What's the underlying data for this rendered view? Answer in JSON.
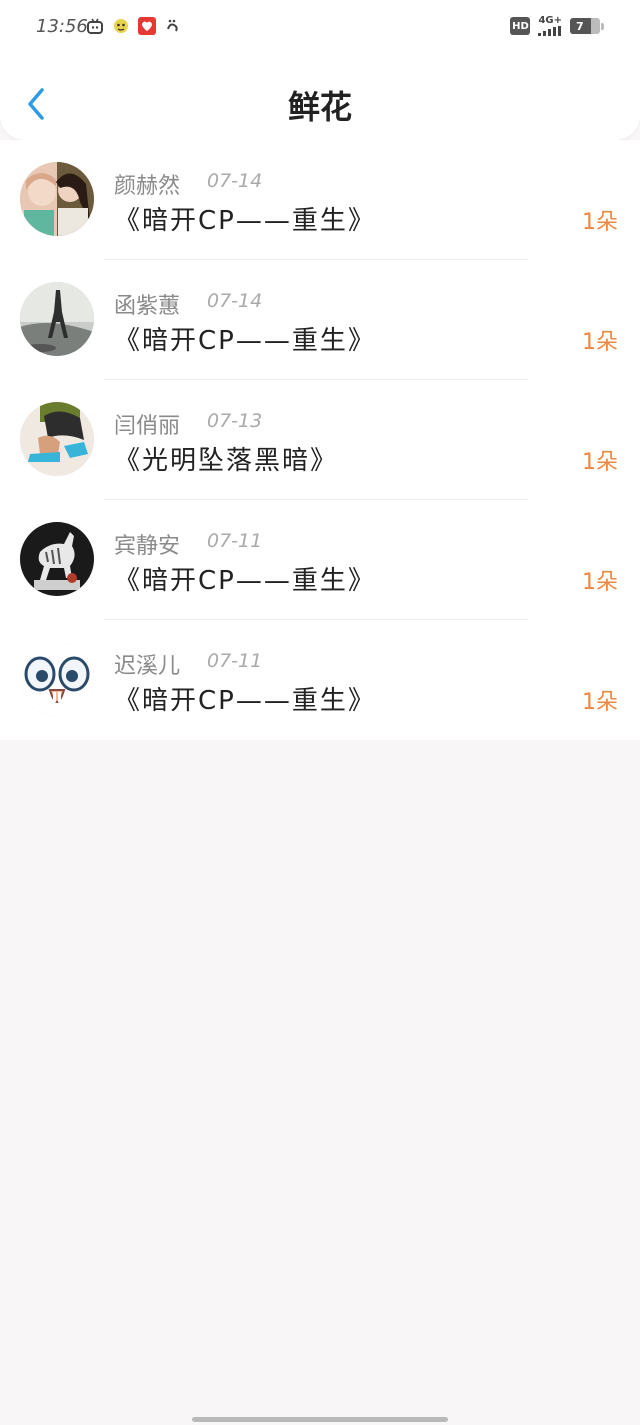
{
  "status_bar": {
    "time": "13:56",
    "hd_label": "HD",
    "network_label": "4G+",
    "battery_level": "7"
  },
  "header": {
    "title": "鲜花"
  },
  "gifts": [
    {
      "name": "颜赫然",
      "date": "07-14",
      "book": "《暗开CP——重生》",
      "count": "1朵"
    },
    {
      "name": "函紫蕙",
      "date": "07-14",
      "book": "《暗开CP——重生》",
      "count": "1朵"
    },
    {
      "name": "闫俏丽",
      "date": "07-13",
      "book": "《光明坠落黑暗》",
      "count": "1朵"
    },
    {
      "name": "宾静安",
      "date": "07-11",
      "book": "《暗开CP——重生》",
      "count": "1朵"
    },
    {
      "name": "迟溪儿",
      "date": "07-11",
      "book": "《暗开CP——重生》",
      "count": "1朵"
    }
  ],
  "colors": {
    "accent_blue": "#2f9be8",
    "count_orange": "#f0873e",
    "background": "#f8f6f7"
  }
}
